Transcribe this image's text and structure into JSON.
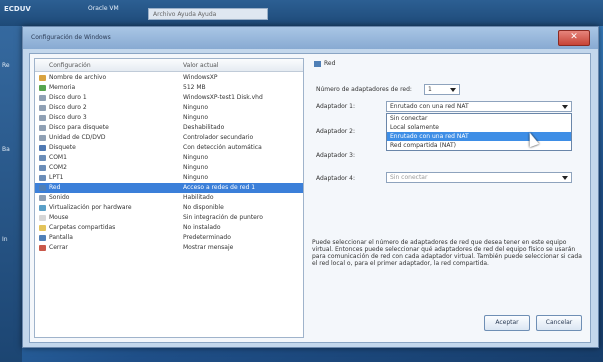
{
  "taskbar": {
    "app_title": "ECDUV",
    "window_label": "Oracle VM",
    "menu_text": "Archivo  Ayuda  Ayuda"
  },
  "desktop": {
    "left_labels": [
      "Re",
      "Ba",
      "In"
    ]
  },
  "window": {
    "title": "Configuración de Windows"
  },
  "list": {
    "col_config": "Configuración",
    "col_value": "Valor actual",
    "rows": [
      {
        "name": "Nombre de archivo",
        "value": "WindowsXP",
        "color": "#d9a340"
      },
      {
        "name": "Memoria",
        "value": "512 MB",
        "color": "#57a54f"
      },
      {
        "name": "Disco duro 1",
        "value": "WindowsXP-test1 Disk.vhd",
        "color": "#8fa0b4"
      },
      {
        "name": "Disco duro 2",
        "value": "Ninguno",
        "color": "#8fa0b4"
      },
      {
        "name": "Disco duro 3",
        "value": "Ninguno",
        "color": "#8fa0b4"
      },
      {
        "name": "Disco para disquete",
        "value": "Deshabilitado",
        "color": "#8fa0b4"
      },
      {
        "name": "Unidad de CD/DVD",
        "value": "Controlador secundario",
        "color": "#8fa0b4"
      },
      {
        "name": "Disquete",
        "value": "Con detección automática",
        "color": "#4f79b3"
      },
      {
        "name": "COM1",
        "value": "Ninguno",
        "color": "#6b8db8"
      },
      {
        "name": "COM2",
        "value": "Ninguno",
        "color": "#6b8db8"
      },
      {
        "name": "LPT1",
        "value": "Ninguno",
        "color": "#6b8db8"
      },
      {
        "name": "Red",
        "value": "Acceso a redes de red 1",
        "color": "#4f7fb6"
      },
      {
        "name": "Sonido",
        "value": "Habilitado",
        "color": "#8fa0b4"
      },
      {
        "name": "Virtualización por hardware",
        "value": "No disponible",
        "color": "#5aa0c8"
      },
      {
        "name": "Mouse",
        "value": "Sin integración de puntero",
        "color": "#d6d6d6"
      },
      {
        "name": "Carpetas compartidas",
        "value": "No instalado",
        "color": "#e3c35a"
      },
      {
        "name": "Pantalla",
        "value": "Predeterminado",
        "color": "#5080b8"
      },
      {
        "name": "Cerrar",
        "value": "Mostrar mensaje",
        "color": "#c9584a"
      }
    ],
    "selected_index": 11
  },
  "pane": {
    "header": "Red",
    "num_adapters_label": "Número de adaptadores de red:",
    "num_adapters_value": "1",
    "adapters": [
      {
        "label": "Adaptador 1:",
        "value": "Enrutado con una red NAT"
      },
      {
        "label": "Adaptador 2:",
        "value": ""
      },
      {
        "label": "Adaptador 3:",
        "value": ""
      },
      {
        "label": "Adaptador 4:",
        "value": "Sin conectar"
      }
    ],
    "dropdown_options": [
      "Sin conectar",
      "Local solamente",
      "Enrutado con una red NAT",
      "Red compartida (NAT)"
    ],
    "dropdown_selected": 2,
    "description": "Puede seleccionar el número de adaptadores de red que desea tener en este equipo virtual. Entonces puede seleccionar qué adaptadores de red del equipo físico se usarán para comunicación de red con cada adaptador virtual. También puede seleccionar si cada el red local o, para el primer adaptador, la red compartida."
  },
  "buttons": {
    "accept": "Aceptar",
    "cancel": "Cancelar",
    "close_glyph": "✕"
  }
}
